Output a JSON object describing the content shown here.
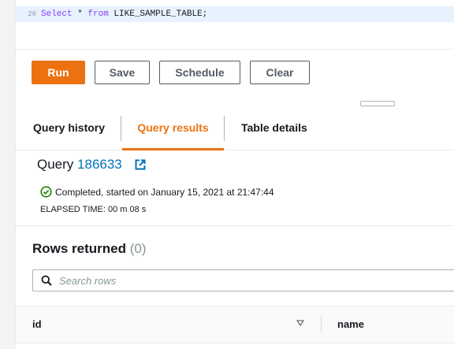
{
  "editor": {
    "line_number": "26",
    "kw_select": "Select",
    "star": " * ",
    "kw_from": "from",
    "table_name": " LIKE_SAMPLE_TABLE;"
  },
  "toolbar": {
    "run_label": "Run",
    "save_label": "Save",
    "schedule_label": "Schedule",
    "clear_label": "Clear"
  },
  "tabs": [
    {
      "label": "Query history",
      "active": false
    },
    {
      "label": "Query results",
      "active": true
    },
    {
      "label": "Table details",
      "active": false
    }
  ],
  "query": {
    "prefix": "Query ",
    "id": "186633",
    "status": "Completed, started on January 15, 2021 at 21:47:44",
    "elapsed": "ELAPSED TIME: 00 m 08 s"
  },
  "rows": {
    "title": "Rows returned",
    "count": "(0)"
  },
  "search": {
    "placeholder": "Search rows"
  },
  "table": {
    "columns": [
      "id",
      "name"
    ]
  },
  "colors": {
    "accent": "#ec7211",
    "link": "#0073bb",
    "success": "#1d8102",
    "keyword": "#8a3ffc"
  },
  "icons": {
    "external_link": "external-link-icon",
    "status": "check-circle-icon",
    "search": "search-icon",
    "sort": "sort-down-icon"
  }
}
